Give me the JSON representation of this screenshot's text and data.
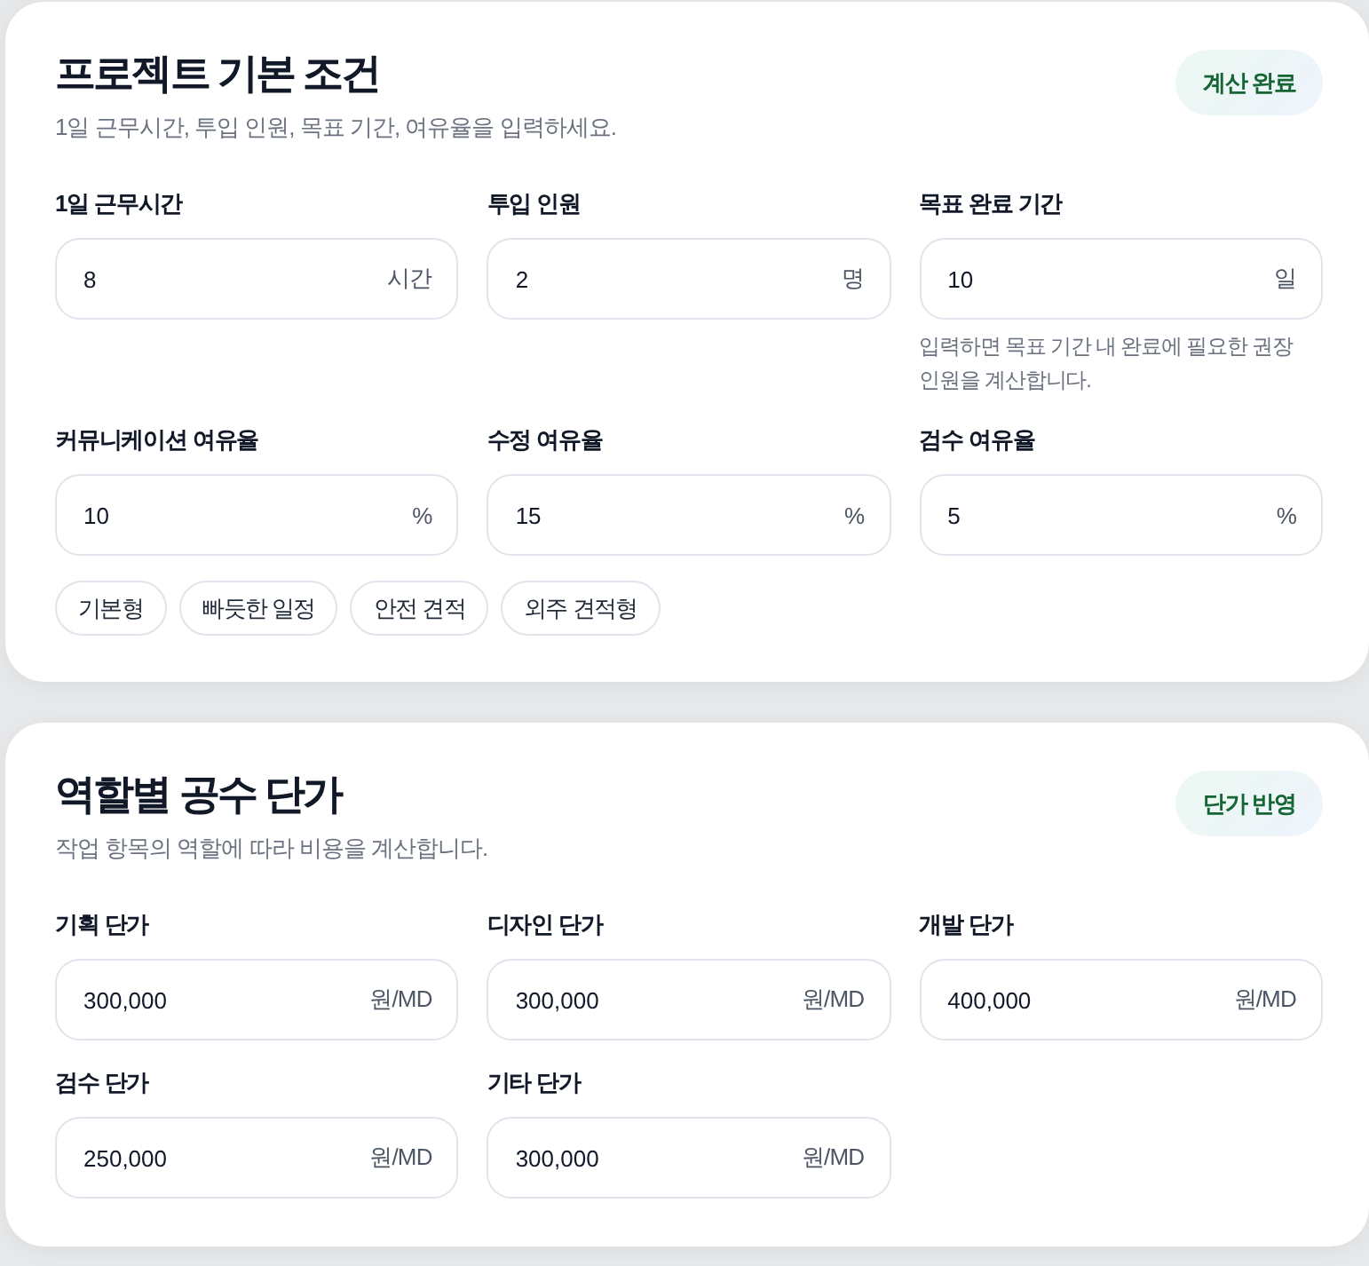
{
  "sections": [
    {
      "title": "프로젝트 기본 조건",
      "description": "1일 근무시간, 투입 인원, 목표 기간, 여유율을 입력하세요.",
      "badge": "계산 완료",
      "fields": [
        {
          "label": "1일 근무시간",
          "value": "8",
          "unit": "시간"
        },
        {
          "label": "투입 인원",
          "value": "2",
          "unit": "명"
        },
        {
          "label": "목표 완료 기간",
          "value": "10",
          "unit": "일",
          "hint": "입력하면 목표 기간 내 완료에 필요한 권장 인원을 계산합니다."
        },
        {
          "label": "커뮤니케이션 여유율",
          "value": "10",
          "unit": "%"
        },
        {
          "label": "수정 여유율",
          "value": "15",
          "unit": "%"
        },
        {
          "label": "검수 여유율",
          "value": "5",
          "unit": "%"
        }
      ],
      "presets": [
        "기본형",
        "빠듯한 일정",
        "안전 견적",
        "외주 견적형"
      ]
    },
    {
      "title": "역할별 공수 단가",
      "description": "작업 항목의 역할에 따라 비용을 계산합니다.",
      "badge": "단가 반영",
      "fields": [
        {
          "label": "기획 단가",
          "value": "300,000",
          "unit": "원/MD"
        },
        {
          "label": "디자인 단가",
          "value": "300,000",
          "unit": "원/MD"
        },
        {
          "label": "개발 단가",
          "value": "400,000",
          "unit": "원/MD"
        },
        {
          "label": "검수 단가",
          "value": "250,000",
          "unit": "원/MD"
        },
        {
          "label": "기타 단가",
          "value": "300,000",
          "unit": "원/MD"
        }
      ]
    }
  ]
}
